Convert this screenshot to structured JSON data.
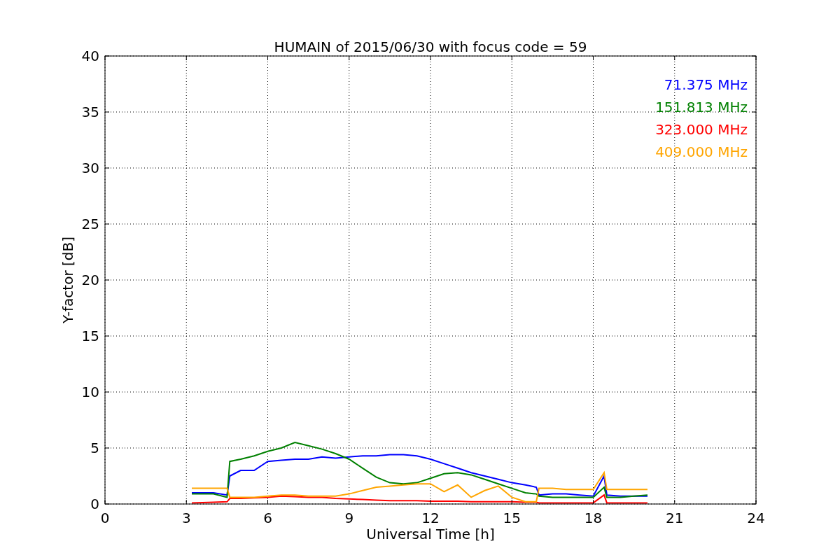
{
  "chart_data": {
    "type": "line",
    "title": "HUMAIN of 2015/06/30 with focus code = 59",
    "xlabel": "Universal Time [h]",
    "ylabel": "Y-factor [dB]",
    "x": [
      3.2,
      4,
      4.5,
      4.6,
      5,
      5.5,
      6,
      6.5,
      7,
      7.5,
      8,
      8.5,
      9,
      9.5,
      10,
      10.5,
      11,
      11.5,
      12,
      12.5,
      13,
      13.5,
      14,
      14.5,
      15,
      15.5,
      15.9,
      16,
      16.5,
      17,
      17.5,
      18,
      18.4,
      18.5,
      19,
      19.5,
      20
    ],
    "series": [
      {
        "name": "71.375 MHz",
        "color": "#0000ff",
        "values": [
          1.0,
          1.0,
          0.8,
          2.5,
          3.0,
          3.0,
          3.8,
          3.9,
          4.0,
          4.0,
          4.2,
          4.1,
          4.2,
          4.3,
          4.3,
          4.4,
          4.4,
          4.3,
          4.0,
          3.6,
          3.2,
          2.8,
          2.5,
          2.2,
          1.9,
          1.7,
          1.5,
          0.8,
          0.9,
          0.9,
          0.8,
          0.7,
          2.5,
          0.8,
          0.7,
          0.7,
          0.7
        ]
      },
      {
        "name": "151.813 MHz",
        "color": "#008000",
        "values": [
          0.9,
          0.9,
          0.6,
          3.8,
          4.0,
          4.3,
          4.7,
          5.0,
          5.5,
          5.2,
          4.9,
          4.5,
          4.0,
          3.2,
          2.4,
          1.9,
          1.8,
          1.9,
          2.3,
          2.7,
          2.8,
          2.6,
          2.2,
          1.8,
          1.4,
          1.0,
          0.9,
          0.7,
          0.6,
          0.6,
          0.6,
          0.6,
          1.5,
          0.6,
          0.6,
          0.7,
          0.8
        ]
      },
      {
        "name": "323.000 MHz",
        "color": "#ff0000",
        "values": [
          0.1,
          0.15,
          0.2,
          0.5,
          0.5,
          0.55,
          0.6,
          0.7,
          0.65,
          0.6,
          0.6,
          0.5,
          0.45,
          0.4,
          0.35,
          0.3,
          0.3,
          0.3,
          0.25,
          0.25,
          0.25,
          0.2,
          0.2,
          0.2,
          0.2,
          0.15,
          0.15,
          0.1,
          0.1,
          0.1,
          0.1,
          0.1,
          0.8,
          0.1,
          0.1,
          0.1,
          0.1
        ]
      },
      {
        "name": "409.000 MHz",
        "color": "#ffa500",
        "values": [
          1.4,
          1.4,
          1.4,
          0.6,
          0.6,
          0.6,
          0.7,
          0.8,
          0.8,
          0.7,
          0.7,
          0.7,
          0.9,
          1.2,
          1.5,
          1.6,
          1.7,
          1.8,
          1.8,
          1.1,
          1.7,
          0.6,
          1.2,
          1.6,
          0.6,
          0.2,
          0.2,
          1.4,
          1.4,
          1.3,
          1.3,
          1.3,
          2.8,
          1.3,
          1.3,
          1.3,
          1.3
        ]
      }
    ],
    "grid": true,
    "xlim": [
      0,
      24
    ],
    "ylim": [
      0,
      40
    ],
    "xticks": [
      0,
      3,
      6,
      9,
      12,
      15,
      18,
      21,
      24
    ],
    "yticks": [
      0,
      5,
      10,
      15,
      20,
      25,
      30,
      35,
      40
    ]
  }
}
